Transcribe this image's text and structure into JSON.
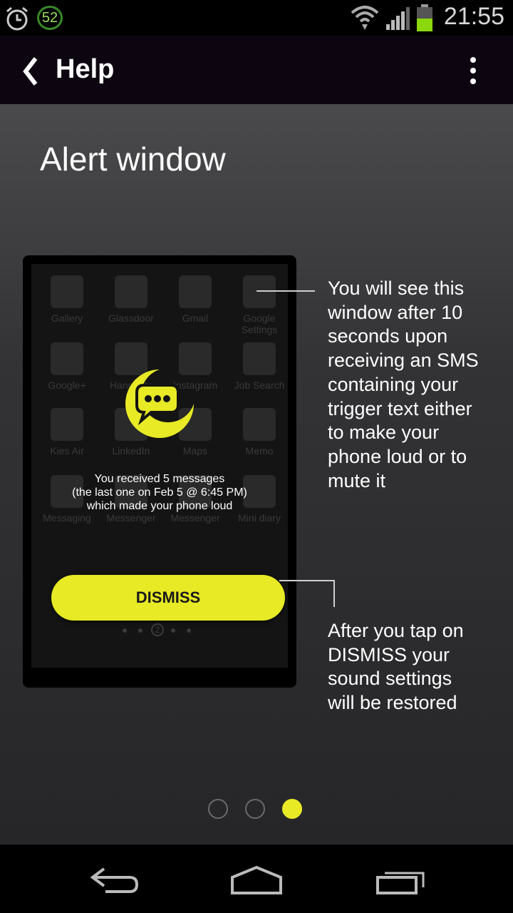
{
  "status_bar": {
    "badge": "52",
    "time": "21:55"
  },
  "app_bar": {
    "title": "Help"
  },
  "page": {
    "title": "Alert window"
  },
  "phone_preview": {
    "apps": [
      {
        "label": "Gallery"
      },
      {
        "label": "Glassdoor"
      },
      {
        "label": "Gmail"
      },
      {
        "label": "Google Settings"
      },
      {
        "label": "Google+"
      },
      {
        "label": "Hangouts"
      },
      {
        "label": "Instagram"
      },
      {
        "label": "Job Search"
      },
      {
        "label": "Kies Air"
      },
      {
        "label": "LinkedIn"
      },
      {
        "label": "Maps"
      },
      {
        "label": "Memo"
      },
      {
        "label": "Messaging"
      },
      {
        "label": "Messenger"
      },
      {
        "label": "Messenger"
      },
      {
        "label": "Mini diary"
      }
    ],
    "message_line1": "You received 5 messages",
    "message_line2": "(the last one on Feb 5 @ 6:45 PM)",
    "message_line3": "which made your phone loud",
    "dismiss_label": "DISMISS",
    "page_indicator": "2"
  },
  "callouts": {
    "top": [
      "You will see this",
      "window after 10",
      "seconds upon",
      "receiving an SMS",
      "containing your",
      "trigger text either",
      "to make your",
      "phone loud or to",
      "mute it"
    ],
    "bottom": [
      "After you tap on",
      "DISMISS your",
      "sound settings",
      "will be restored"
    ]
  },
  "pager": {
    "count": 3,
    "active_index": 2
  },
  "colors": {
    "accent": "#e7ea24",
    "appbar": "#0d0610"
  }
}
